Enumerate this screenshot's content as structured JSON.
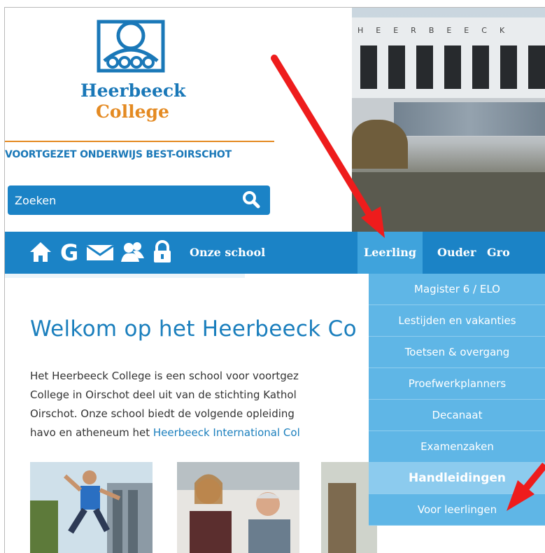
{
  "logo": {
    "line1": "Heerbeeck",
    "line2": "College",
    "tagline": "VOORTGEZET ONDERWIJS BEST-OIRSCHOT"
  },
  "photo": {
    "building_letters": "HEERBEECK"
  },
  "search": {
    "placeholder": "Zoeken",
    "icon": "search-icon"
  },
  "nav": {
    "icons": [
      "home-icon",
      "google-icon",
      "mail-icon",
      "users-icon",
      "lock-icon"
    ],
    "items": [
      {
        "label": "Onze school",
        "active": false
      },
      {
        "label": "Leerling",
        "active": true
      },
      {
        "label": "Ouder",
        "active": false
      },
      {
        "label": "Gro",
        "active": false
      }
    ]
  },
  "dropdown": {
    "items": [
      {
        "label": "Magister 6 / ELO"
      },
      {
        "label": "Lestijden en vakanties"
      },
      {
        "label": "Toetsen & overgang"
      },
      {
        "label": "Proefwerkplanners"
      },
      {
        "label": "Decanaat"
      },
      {
        "label": "Examenzaken"
      },
      {
        "label": "Handleidingen",
        "highlighted": true
      },
      {
        "label": "Voor leerlingen"
      }
    ]
  },
  "main": {
    "heading": "Welkom op het Heerbeeck Co",
    "paragraph": {
      "line1": "Het Heerbeeck College is een school voor voortgez",
      "line2": "College in Oirschot deel uit van de stichting Kathol",
      "line3": "Oirschot. Onze school biedt de volgende opleiding",
      "line4_prefix": "havo en atheneum het ",
      "line4_link": "Heerbeeck International Col"
    }
  },
  "colors": {
    "brand_blue": "#1b83c6",
    "brand_orange": "#e48a22",
    "dropdown_bg": "#5fb6e6",
    "highlight_bg": "#8ccbee",
    "annotation_arrow": "#ee1c1c"
  }
}
